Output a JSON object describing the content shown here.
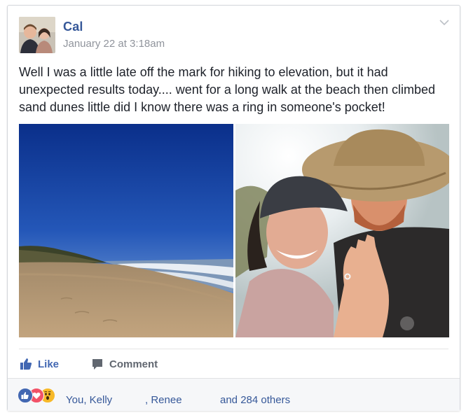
{
  "post": {
    "author": "Cal",
    "timestamp": "January 22 at 3:18am",
    "text": "Well I was a little late off the mark for hiking to elevation, but it had unexpected results today.... went for a long walk at the beach then climbed sand dunes little did I know there was a ring in someone's pocket!"
  },
  "actions": {
    "like_label": "Like",
    "comment_label": "Comment"
  },
  "reactions": {
    "icons": [
      "like-reaction-icon",
      "love-reaction-icon",
      "wow-reaction-icon"
    ],
    "names": [
      "You, Kelly",
      ", Renee"
    ],
    "others": "and 284 others"
  },
  "colors": {
    "link": "#365899",
    "like_blue": "#4267b2",
    "love_red": "#f25268",
    "wow_yellow": "#f7b928",
    "meta_gray": "#90949c"
  }
}
